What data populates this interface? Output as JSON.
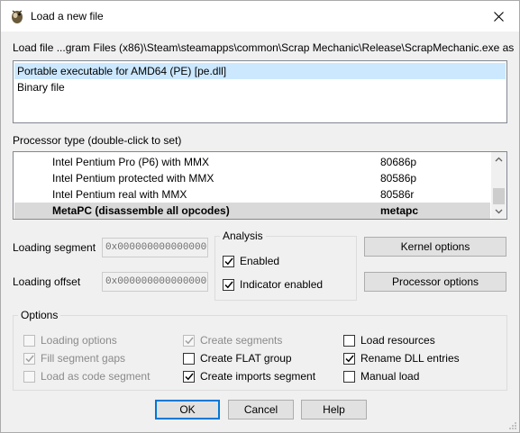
{
  "window": {
    "title": "Load a new file",
    "icon": "bug-icon"
  },
  "load_file_label": "Load file ...gram Files (x86)\\Steam\\steamapps\\common\\Scrap Mechanic\\Release\\ScrapMechanic.exe as",
  "file_types": [
    {
      "label": "Portable executable for AMD64 (PE) [pe.dll]",
      "selected": true
    },
    {
      "label": "Binary file",
      "selected": false
    }
  ],
  "processor_label": "Processor type (double-click to set)",
  "processors": [
    {
      "name": "Intel Pentium Pro (P6) with MMX",
      "code": "80686p",
      "selected": false
    },
    {
      "name": "Intel Pentium protected with MMX",
      "code": "80586p",
      "selected": false
    },
    {
      "name": "Intel Pentium real with MMX",
      "code": "80586r",
      "selected": false
    },
    {
      "name": "MetaPC (disassemble all opcodes)",
      "code": "metapc",
      "selected": true
    }
  ],
  "loading_segment": {
    "label": "Loading segment",
    "value": "0x0000000000000000"
  },
  "loading_offset": {
    "label": "Loading offset",
    "value": "0x0000000000000000"
  },
  "analysis": {
    "title": "Analysis",
    "enabled": {
      "label": "Enabled",
      "checked": true
    },
    "indicator": {
      "label": "Indicator enabled",
      "checked": true
    }
  },
  "kernel_options_label": "Kernel options",
  "processor_options_label": "Processor options",
  "options": {
    "title": "Options",
    "loading_options": {
      "label": "Loading options",
      "checked": false,
      "disabled": true
    },
    "fill_segment_gaps": {
      "label": "Fill segment gaps",
      "checked": true,
      "disabled": true
    },
    "load_as_code_segment": {
      "label": "Load as code segment",
      "checked": false,
      "disabled": true
    },
    "create_segments": {
      "label": "Create segments",
      "checked": true,
      "disabled": true
    },
    "create_flat_group": {
      "label": "Create FLAT group",
      "checked": false,
      "disabled": false
    },
    "create_imports_segment": {
      "label": "Create imports segment",
      "checked": true,
      "disabled": false
    },
    "load_resources": {
      "label": "Load resources",
      "checked": false,
      "disabled": false
    },
    "rename_dll_entries": {
      "label": "Rename DLL entries",
      "checked": true,
      "disabled": false
    },
    "manual_load": {
      "label": "Manual load",
      "checked": false,
      "disabled": false
    }
  },
  "buttons": {
    "ok": "OK",
    "cancel": "Cancel",
    "help": "Help"
  },
  "colors": {
    "selection": "#cce8ff",
    "accent": "#0078d7"
  }
}
